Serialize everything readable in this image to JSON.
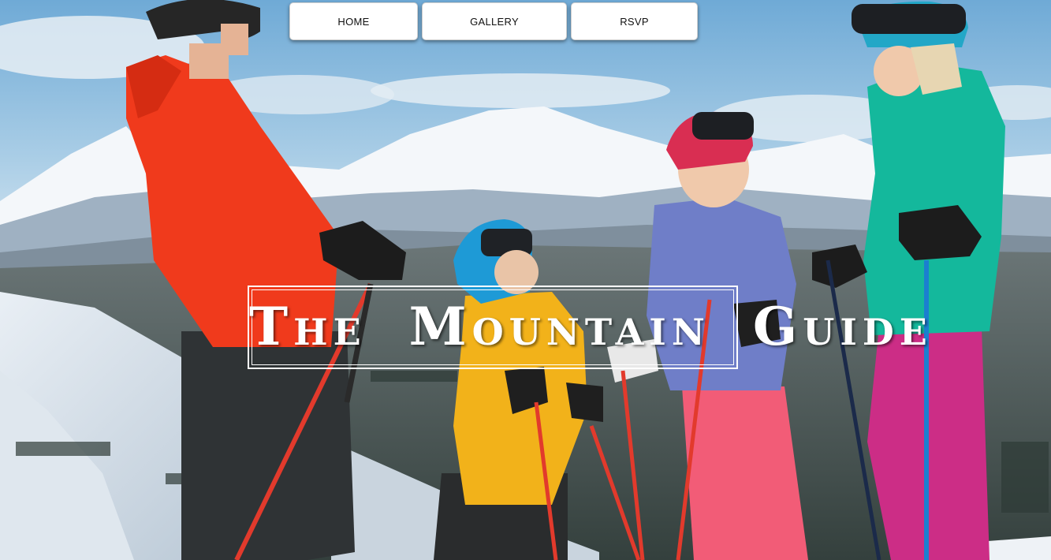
{
  "nav": {
    "home_label": "HOME",
    "gallery_label": "GALLERY",
    "rsvp_label": "RSVP"
  },
  "hero": {
    "title": "The Mountain Guide",
    "image_subject": "family-skiers-on-mountain-photo"
  },
  "colors": {
    "sky": "#8fc0e0",
    "snow": "#f2f5f8",
    "forest": "#3f4a46",
    "red_jacket": "#f03a1c",
    "teal_jacket": "#14b89c",
    "yellow_jacket": "#f2b21a",
    "purple_jacket": "#6f7ec8",
    "pink_pants": "#f25c77",
    "magenta_pants": "#cc2d86"
  }
}
